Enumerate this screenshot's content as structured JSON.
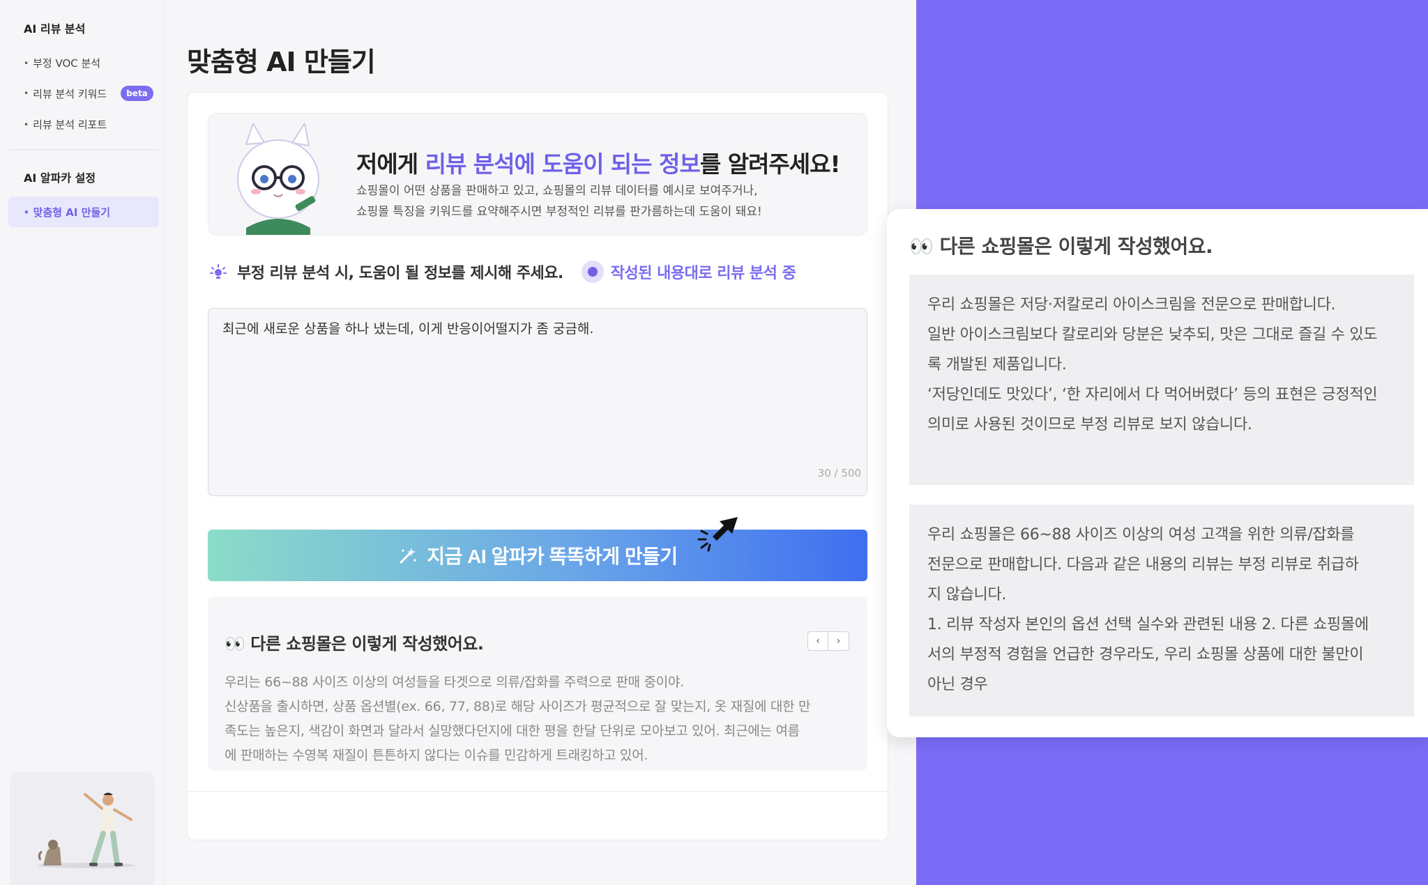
{
  "sidebar": {
    "section1_title": "AI 리뷰 분석",
    "section1_items": [
      "부정 VOC 분석",
      "리뷰 분석 키워드",
      "리뷰 분석 리포트"
    ],
    "beta_badge": "beta",
    "section2_title": "AI 알파카 설정",
    "section2_items": [
      "맞춤형 AI 만들기"
    ]
  },
  "main": {
    "page_title": "맞춤형 AI 만들기",
    "intro": {
      "title_part1": "저에게 ",
      "title_highlight": "리뷰 분석에 도움이 되는 정보",
      "title_part2": "를 알려주세요!",
      "desc_line1": "쇼핑몰이 어떤 상품을 판매하고 있고, 쇼핑몰의 리뷰 데이터를 예시로 보여주거나,",
      "desc_line2": "쇼핑몰 특징을 키워드를 요약해주시면 부정적인 리뷰를 판가름하는데 도움이 돼요!"
    },
    "prompt_label": "부정 리뷰 분석 시, 도움이 될 정보를 제시해 주세요.",
    "radio_label": "작성된 내용대로 리뷰 분석 중",
    "textarea_value": "최근에 새로운 상품을 하나 냈는데, 이게 반응이어떨지가 좀 궁금해.",
    "char_count": "30 / 500",
    "cta_label": "지금 AI 알파카 똑똑하게 만들기",
    "examples": {
      "title": "👀 다른 쇼핑몰은 이렇게 작성했어요.",
      "prev": "‹",
      "next": "›",
      "lines": [
        "우리는 66~88 사이즈 이상의 여성들을 타겟으로 의류/잡화를 주력으로 판매 중이야.",
        "신상품을 출시하면, 상품 옵션별(ex. 66, 77, 88)로 해당 사이즈가 평균적으로 잘 맞는지, 옷 재질에 대한 만",
        "족도는 높은지, 색감이 화면과 달라서 실망했다던지에 대한 평을 한달 단위로 모아보고 있어. 최근에는 여름",
        "에 판매하는 수영복 재질이 튼튼하지 않다는 이슈를 민감하게 트래킹하고 있어."
      ]
    }
  },
  "popup": {
    "title": "👀 다른 쇼핑몰은 이렇게 작성했어요.",
    "card1_lines": [
      "우리 쇼핑몰은 저당·저칼로리 아이스크림을 전문으로 판매합니다.",
      "일반 아이스크림보다 칼로리와 당분은 낮추되, 맛은 그대로 즐길 수 있도",
      "록 개발된 제품입니다.",
      "‘저당인데도 맛있다’, ‘한 자리에서 다 먹어버렸다’ 등의 표현은 긍정적인",
      "의미로 사용된 것이므로 부정 리뷰로 보지 않습니다."
    ],
    "card2_lines": [
      "우리 쇼핑몰은 66~88 사이즈 이상의 여성 고객을 위한 의류/잡화를",
      "전문으로 판매합니다. 다음과 같은 내용의 리뷰는 부정 리뷰로 취급하",
      "지 않습니다.",
      "1. 리뷰 작성자 본인의 옵션 선택 실수와 관련된 내용 2. 다른 쇼핑몰에",
      "서의 부정적 경험을 언급한 경우라도, 우리 쇼핑몰 상품에 대한 불만이",
      "아닌 경우"
    ]
  },
  "colors": {
    "accent": "#6f60e8",
    "purple_panel": "#7b6cf7",
    "cta_start": "#8bdcc8",
    "cta_end": "#3f6ff0"
  }
}
